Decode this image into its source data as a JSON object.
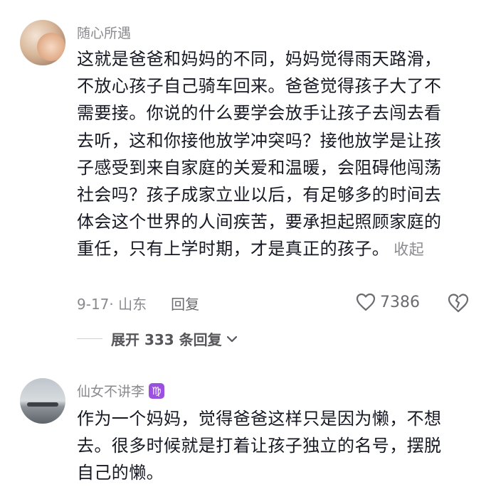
{
  "comments": [
    {
      "username": "随心所遇",
      "text_lines": [
        "这就是爸爸和妈妈的不同，妈妈觉得雨天路滑，",
        "不放心孩子自己骑车回来。爸爸觉得孩子大了不",
        "需要接。你说的什么要学会放手让孩子去闯去看",
        "去听，这和你接他放学冲突吗？接他放学是让孩",
        "子感受到来自家庭的关爱和温暖，会阻碍他闯荡",
        "社会吗？孩子成家立业以后，有足够多的时间去",
        "体会这个世界的人间疾苦，要承担起照顾家庭的",
        "重任，只有上学时期，才是真正的孩子。"
      ],
      "collapse_label": "收起",
      "date_location": "9-17· 山东",
      "reply_label": "回复",
      "like_count": "7386",
      "expand_label": "展开 333 条回复"
    },
    {
      "username": "仙女不讲李",
      "badge": "♍",
      "text_lines": [
        "作为一个妈妈，觉得爸爸这样只是因为懒，不想",
        "去。很多时候就是打着让孩子独立的名号，摆脱",
        "自己的懒。"
      ]
    }
  ],
  "icons": {
    "like": "heart-outline-icon",
    "dislike": "broken-heart-icon",
    "expand": "chevron-down-icon",
    "badge": "virgo-icon"
  },
  "colors": {
    "text": "#161823",
    "muted": "#8a8a8f",
    "badge": "#9b51e0"
  }
}
